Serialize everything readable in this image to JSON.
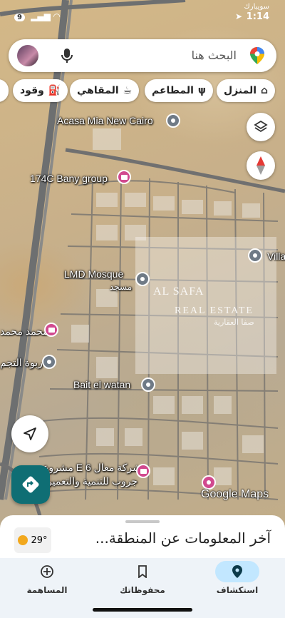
{
  "status_bar": {
    "time": "1:14",
    "carrier": "سويبارك",
    "signal": "9"
  },
  "search": {
    "placeholder": "البحث هنا"
  },
  "chips": [
    {
      "label": "المنزل",
      "icon": "home-icon"
    },
    {
      "label": "المطاعم",
      "icon": "restaurant-icon"
    },
    {
      "label": "المقاهي",
      "icon": "cafe-icon"
    },
    {
      "label": "وقود",
      "icon": "fuel-icon"
    }
  ],
  "map": {
    "places": {
      "acasa": "Acasa Mia New Cairo",
      "bany": "174C Bany group",
      "lmd": "LMD Mosque",
      "lmd_sub": "مسجد",
      "vill": "Villa",
      "mohamed": "محمد محمد",
      "rabwa": "ربوة التجم",
      "bait": "Bait el watan",
      "project_line1": "مشروع E 6 شركة معال",
      "project_line2": "جروب للتنمية والتعمير"
    },
    "watermark": {
      "line1": "AL SAFA",
      "line2": "REAL ESTATE",
      "line3": "صفا العقارية"
    },
    "attribution": "Google Maps"
  },
  "sheet": {
    "title": "آخر المعلومات عن المنطقة...",
    "temperature": "29°"
  },
  "nav": [
    {
      "label": "استكشاف",
      "icon": "explore-pin-icon",
      "active": true
    },
    {
      "label": "محفوظاتك",
      "icon": "bookmark-icon",
      "active": false
    },
    {
      "label": "المساهمة",
      "icon": "add-circle-icon",
      "active": false
    }
  ],
  "colors": {
    "nav_active": "#c2e7ff",
    "navigate_fab": "#0f6e74",
    "pin_pink": "#d1498f",
    "pin_gray": "#6f7a86"
  }
}
